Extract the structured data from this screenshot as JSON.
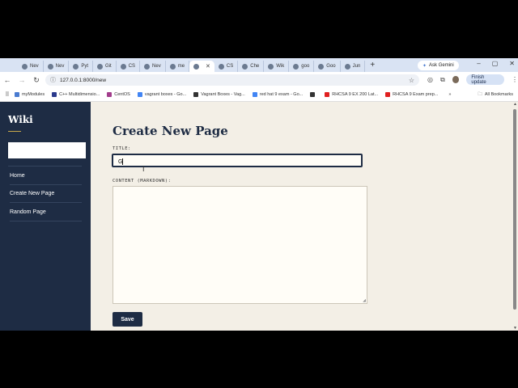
{
  "browser": {
    "tabs": [
      {
        "label": "Nev"
      },
      {
        "label": "Nev"
      },
      {
        "label": "Pyt"
      },
      {
        "label": "Git"
      },
      {
        "label": "CS"
      },
      {
        "label": "Nev"
      },
      {
        "label": "me"
      },
      {
        "label": "",
        "active": true
      },
      {
        "label": "CS"
      },
      {
        "label": "Che"
      },
      {
        "label": "Wik"
      },
      {
        "label": "goo"
      },
      {
        "label": "Goo"
      },
      {
        "label": "Jun"
      }
    ],
    "new_tab": "+",
    "gemini_label": "Ask Gemini",
    "window_controls": {
      "minimize": "–",
      "restore": "▢",
      "close": "✕"
    },
    "url": "127.0.0.1:8000/new",
    "finish_update": "Finish update",
    "bookmarks": [
      {
        "label": "myModules",
        "color": "#4a7bd0"
      },
      {
        "label": "C++ Multidimensio...",
        "color": "#2b3a8c"
      },
      {
        "label": "CentOS",
        "color": "#a23d8c"
      },
      {
        "label": "vagrant boxes - Go...",
        "color": "#4285f4"
      },
      {
        "label": "Vagrant Boxes - Vag...",
        "color": "#333333"
      },
      {
        "label": "red hat 9 exam - Go...",
        "color": "#4285f4"
      },
      {
        "label": "",
        "color": "#333333"
      },
      {
        "label": "RHCSA 9 EX 200 Lat...",
        "color": "#e02020"
      },
      {
        "label": "RHCSA 9 Exam prep...",
        "color": "#e02020"
      }
    ],
    "bookmarks_more": "»",
    "all_bookmarks": "All Bookmarks"
  },
  "sidebar": {
    "brand": "Wiki",
    "search_value": "",
    "items": [
      {
        "label": "Home"
      },
      {
        "label": "Create New Page"
      },
      {
        "label": "Random Page"
      }
    ]
  },
  "main": {
    "heading": "Create New Page",
    "title_label": "TITLE:",
    "title_value": "G",
    "content_label": "CONTENT (MARKDOWN):",
    "content_value": "",
    "save_label": "Save"
  },
  "colors": {
    "sidebar_bg": "#1e2c44",
    "page_bg": "#f3efe6",
    "accent": "#c9a84b"
  }
}
